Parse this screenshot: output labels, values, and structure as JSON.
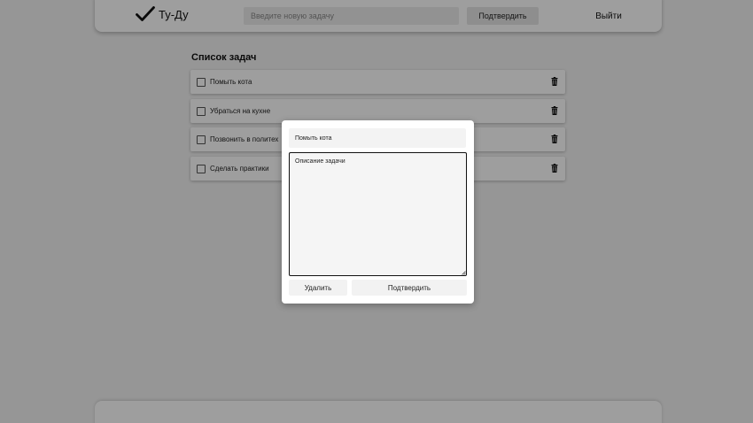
{
  "app": {
    "title": "Ту-Ду"
  },
  "header": {
    "new_task_placeholder": "Введите новую задачу",
    "confirm_label": "Подтвердить",
    "logout_label": "Выйти"
  },
  "list": {
    "title": "Список задач",
    "items": [
      {
        "label": "Помыть кота",
        "icon": "trash-icon"
      },
      {
        "label": "Убраться на кухне",
        "icon": "trash-icon"
      },
      {
        "label": "Позвонить в политех",
        "icon": "trash-icon"
      },
      {
        "label": "Сделать практики",
        "icon": "trash-icon"
      }
    ]
  },
  "modal": {
    "title_value": "Помыть кота",
    "description_placeholder": "Описание задачи",
    "delete_label": "Удалить",
    "confirm_label": "Подтвердить"
  },
  "colors": {
    "background": "#f2f2f2",
    "overlay": "rgba(0,0,0,0.38)",
    "card": "#ffffff"
  }
}
